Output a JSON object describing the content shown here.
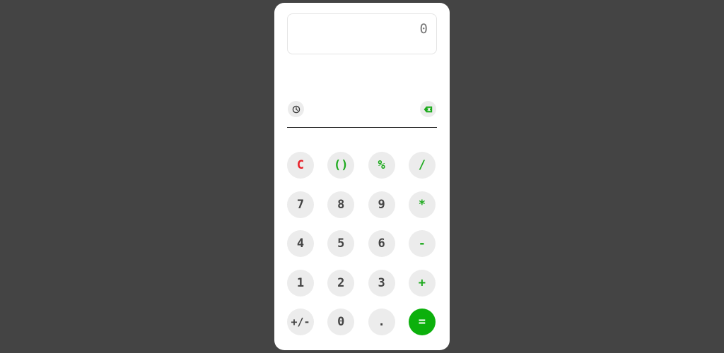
{
  "display": {
    "value": "0"
  },
  "toolbar": {
    "history_icon": "clock-icon",
    "backspace_icon": "backspace-icon"
  },
  "keypad": {
    "keys": [
      {
        "label": "C",
        "role": "clear"
      },
      {
        "label": "()",
        "role": "op"
      },
      {
        "label": "%",
        "role": "op"
      },
      {
        "label": "/",
        "role": "op"
      },
      {
        "label": "7",
        "role": "digit"
      },
      {
        "label": "8",
        "role": "digit"
      },
      {
        "label": "9",
        "role": "digit"
      },
      {
        "label": "*",
        "role": "op"
      },
      {
        "label": "4",
        "role": "digit"
      },
      {
        "label": "5",
        "role": "digit"
      },
      {
        "label": "6",
        "role": "digit"
      },
      {
        "label": "-",
        "role": "op"
      },
      {
        "label": "1",
        "role": "digit"
      },
      {
        "label": "2",
        "role": "digit"
      },
      {
        "label": "3",
        "role": "digit"
      },
      {
        "label": "+",
        "role": "op"
      },
      {
        "label": "+/-",
        "role": "digit"
      },
      {
        "label": "0",
        "role": "digit"
      },
      {
        "label": ".",
        "role": "digit"
      },
      {
        "label": "=",
        "role": "equals"
      }
    ]
  },
  "colors": {
    "background": "#444444",
    "operator": "#1eaa1e",
    "clear": "#e8222a",
    "equals_bg": "#0cb00c",
    "key_bg": "#ececec"
  }
}
